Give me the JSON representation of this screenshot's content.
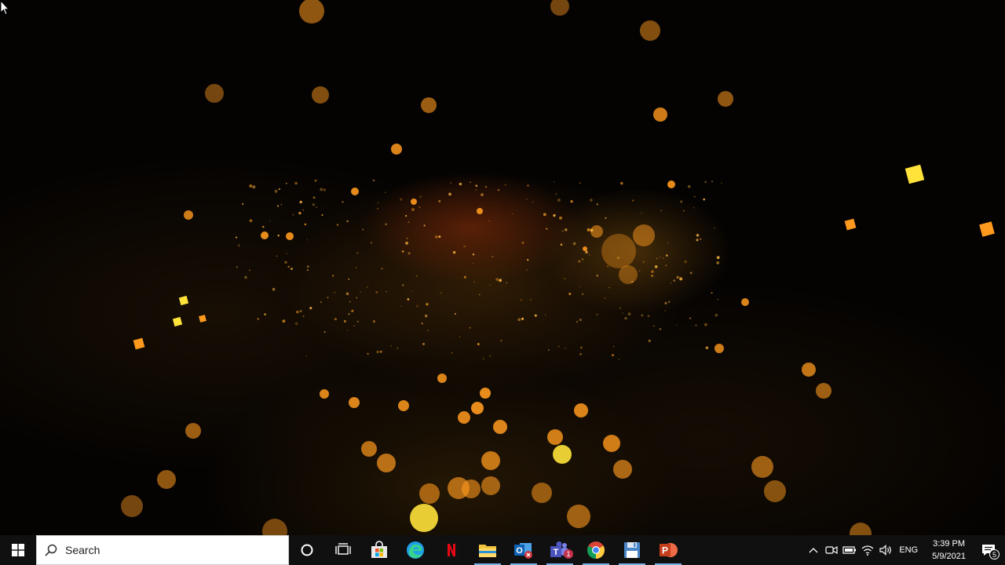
{
  "taskbar": {
    "search_placeholder": "Search",
    "apps": [
      {
        "name": "Cortana",
        "icon": "cortana-icon",
        "active": false
      },
      {
        "name": "Task View",
        "icon": "task-view-icon",
        "active": false
      },
      {
        "name": "Microsoft Store",
        "icon": "store-icon",
        "active": false
      },
      {
        "name": "Microsoft Edge",
        "icon": "edge-icon",
        "active": false
      },
      {
        "name": "Netflix",
        "icon": "netflix-icon",
        "active": false
      },
      {
        "name": "File Explorer",
        "icon": "folder-icon",
        "active": true
      },
      {
        "name": "Outlook",
        "icon": "outlook-icon",
        "active": true
      },
      {
        "name": "Microsoft Teams",
        "icon": "teams-icon",
        "active": true,
        "badge": "1"
      },
      {
        "name": "Google Chrome",
        "icon": "chrome-icon",
        "active": true
      },
      {
        "name": "Save",
        "icon": "floppy-icon",
        "active": true
      },
      {
        "name": "PowerPoint",
        "icon": "powerpoint-icon",
        "active": true
      }
    ],
    "tray": {
      "language": "ENG",
      "time": "3:39 PM",
      "date": "5/9/2021",
      "notification_count": "5"
    }
  },
  "colors": {
    "taskbar_bg": "#101010",
    "active_indicator": "#78b4e6",
    "bokeh_orange": "#ff9a1e",
    "bokeh_yellow": "#ffe23a"
  }
}
